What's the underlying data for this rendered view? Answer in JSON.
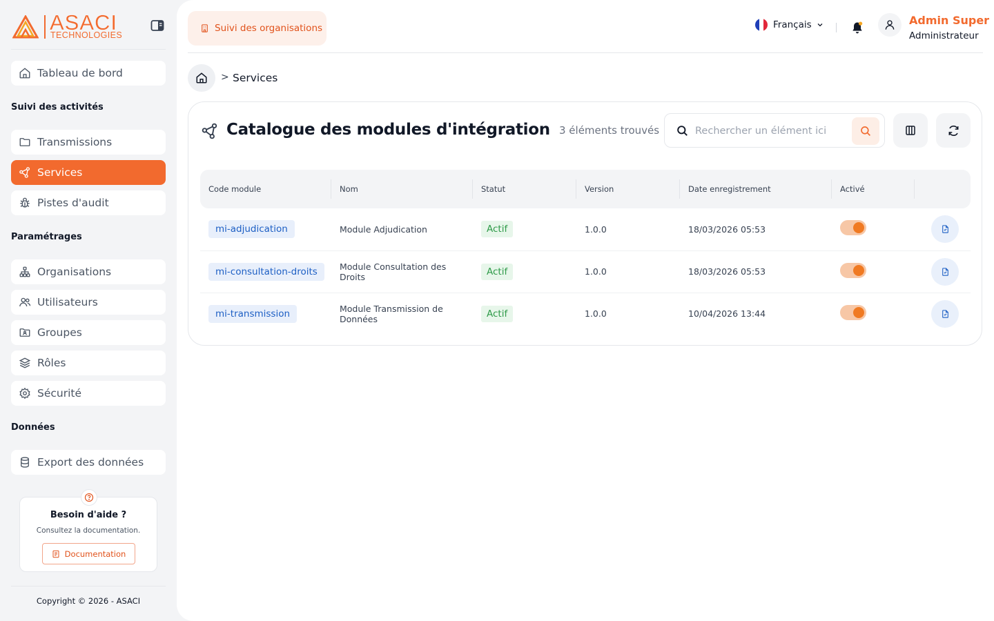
{
  "brand": {
    "name": "ASACI",
    "sub": "TECHNOLOGIES"
  },
  "sidebar": {
    "top_item": {
      "label": "Tableau de bord"
    },
    "sections": [
      {
        "title": "Suivi des activités",
        "items": [
          {
            "label": "Transmissions"
          },
          {
            "label": "Services",
            "active": true
          },
          {
            "label": "Pistes d'audit"
          }
        ]
      },
      {
        "title": "Paramétrages",
        "items": [
          {
            "label": "Organisations"
          },
          {
            "label": "Utilisateurs"
          },
          {
            "label": "Groupes"
          },
          {
            "label": "Rôles"
          },
          {
            "label": "Sécurité"
          }
        ]
      },
      {
        "title": "Données",
        "items": [
          {
            "label": "Export des données"
          }
        ]
      }
    ],
    "help": {
      "title": "Besoin d'aide ?",
      "subtitle": "Consultez la documentation.",
      "button": "Documentation"
    },
    "copyright": "Copyright © 2026 - ASACI"
  },
  "topbar": {
    "org_button": "Suivi des organisations",
    "language": "Français",
    "user": {
      "name": "Admin Super",
      "role": "Administrateur"
    }
  },
  "breadcrumb": {
    "current": "Services",
    "separator": ">"
  },
  "catalog": {
    "title": "Catalogue des modules d'intégration",
    "count": "3 éléments trouvés",
    "search_placeholder": "Rechercher un élément ici",
    "columns": [
      "Code module",
      "Nom",
      "Statut",
      "Version",
      "Date enregistrement",
      "Activé",
      ""
    ],
    "rows": [
      {
        "code": "mi-adjudication",
        "name": "Module Adjudication",
        "status": "Actif",
        "version": "1.0.0",
        "date": "18/03/2026 05:53",
        "enabled": true
      },
      {
        "code": "mi-consultation-droits",
        "name": "Module Consultation des Droits",
        "status": "Actif",
        "version": "1.0.0",
        "date": "18/03/2026 05:53",
        "enabled": true
      },
      {
        "code": "mi-transmission",
        "name": "Module Transmission de Données",
        "status": "Actif",
        "version": "1.0.0",
        "date": "10/04/2026 13:44",
        "enabled": true
      }
    ]
  },
  "colors": {
    "accent": "#f26a2e",
    "link_blue": "#1d5fc4",
    "success_green": "#2e9a48"
  },
  "icons": [
    "collapse-sidebar-icon",
    "home-icon",
    "folder-icon",
    "share-nodes-icon",
    "bug-icon",
    "hierarchy-icon",
    "users-icon",
    "folder-user-icon",
    "layers-icon",
    "gear-icon",
    "database-icon",
    "question-icon",
    "document-icon",
    "building-icon",
    "chevron-down-icon",
    "bell-icon",
    "user-icon",
    "search-icon",
    "columns-icon",
    "refresh-icon",
    "file-icon"
  ]
}
